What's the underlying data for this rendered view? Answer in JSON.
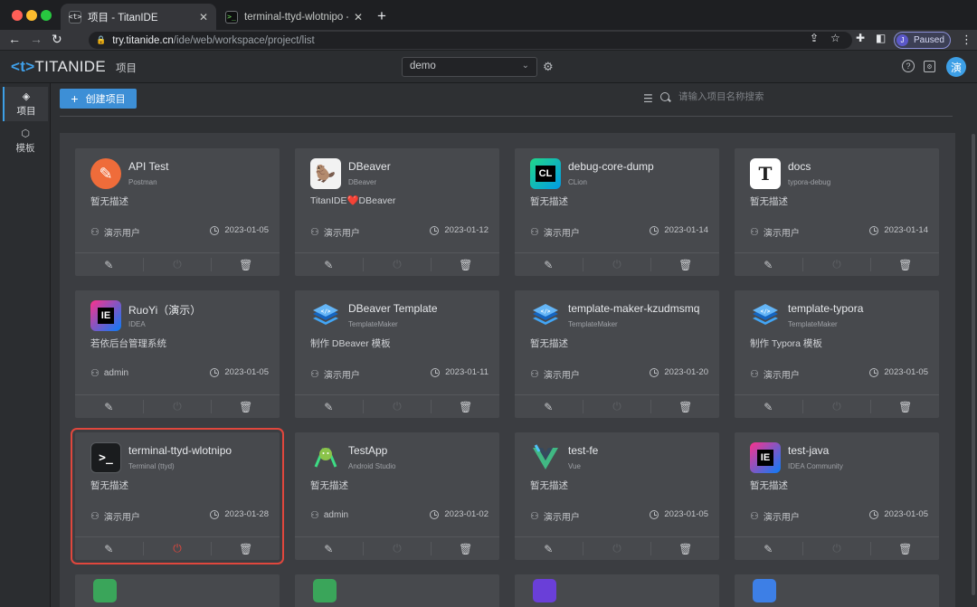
{
  "browser": {
    "tabs": [
      {
        "title": "项目 - TitanIDE",
        "favicon": "<t>"
      },
      {
        "title": "terminal-ttyd-wlotnipo - Titan",
        "favicon": ">_"
      }
    ],
    "url_host": "try.titanide.cn",
    "url_path": "/ide/web/workspace/project/list",
    "profile_initial": "J",
    "profile_status": "Paused"
  },
  "app": {
    "logo_bracket": "<t>",
    "logo_text": "TITANIDE",
    "nav_label": "项目",
    "workspace_value": "demo",
    "avatar_text": "演"
  },
  "sidebar": {
    "items": [
      {
        "label": "项目",
        "icon": "layers-icon"
      },
      {
        "label": "模板",
        "icon": "cube-icon"
      }
    ]
  },
  "toolbar": {
    "create_label": "创建项目",
    "search_placeholder": "请输入项目名称搜索"
  },
  "cards": [
    {
      "name": "API Test",
      "type": "Postman",
      "desc": "暂无描述",
      "user": "演示用户",
      "date": "2023-01-05"
    },
    {
      "name": "DBeaver",
      "type": "DBeaver",
      "desc": "TitanIDE❤️DBeaver",
      "user": "演示用户",
      "date": "2023-01-12"
    },
    {
      "name": "debug-core-dump",
      "type": "CLion",
      "desc": "暂无描述",
      "user": "演示用户",
      "date": "2023-01-14"
    },
    {
      "name": "docs",
      "type": "typora-debug",
      "desc": "暂无描述",
      "user": "演示用户",
      "date": "2023-01-14"
    },
    {
      "name": "RuoYi（演示）",
      "type": "IDEA",
      "desc": "若依后台管理系统",
      "user": "admin",
      "date": "2023-01-05"
    },
    {
      "name": "DBeaver Template",
      "type": "TemplateMaker",
      "desc": "制作 DBeaver 模板",
      "user": "演示用户",
      "date": "2023-01-11"
    },
    {
      "name": "template-maker-kzudmsmq",
      "type": "TemplateMaker",
      "desc": "暂无描述",
      "user": "演示用户",
      "date": "2023-01-20"
    },
    {
      "name": "template-typora",
      "type": "TemplateMaker",
      "desc": "制作 Typora 模板",
      "user": "演示用户",
      "date": "2023-01-05"
    },
    {
      "name": "terminal-ttyd-wlotnipo",
      "type": "Terminal (ttyd)",
      "desc": "暂无描述",
      "user": "演示用户",
      "date": "2023-01-28"
    },
    {
      "name": "TestApp",
      "type": "Android Studio",
      "desc": "暂无描述",
      "user": "admin",
      "date": "2023-01-02"
    },
    {
      "name": "test-fe",
      "type": "Vue",
      "desc": "暂无描述",
      "user": "演示用户",
      "date": "2023-01-05"
    },
    {
      "name": "test-java",
      "type": "IDEA Community",
      "desc": "暂无描述",
      "user": "演示用户",
      "date": "2023-01-05"
    }
  ],
  "icons": {
    "edit": "✎",
    "power": "⏻",
    "delete": "🗑"
  }
}
